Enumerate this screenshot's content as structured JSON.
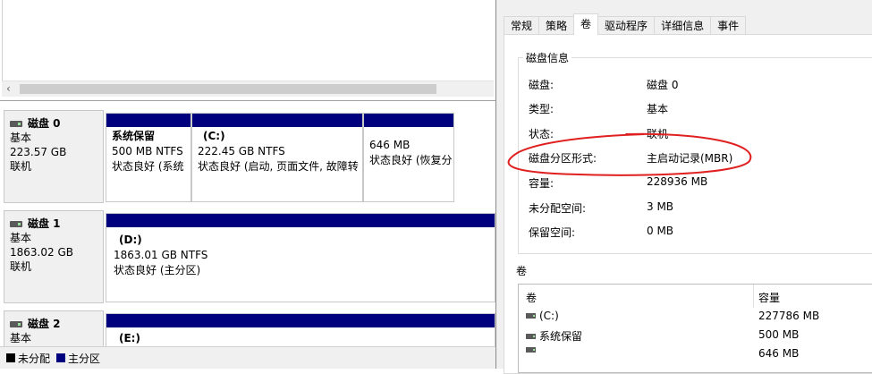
{
  "legend": {
    "unallocated": "未分配",
    "primary": "主分区"
  },
  "disks": [
    {
      "name": "磁盘 0",
      "type": "基本",
      "size": "223.57 GB",
      "status": "联机",
      "partitions": [
        {
          "name": "系统保留",
          "size": "500 MB NTFS",
          "status": "状态良好 (系统"
        },
        {
          "name": "(C:)",
          "size": "222.45 GB NTFS",
          "status": "状态良好 (启动, 页面文件, 故障转"
        },
        {
          "name": "",
          "size": "646 MB",
          "status": "状态良好 (恢复分"
        }
      ]
    },
    {
      "name": "磁盘 1",
      "type": "基本",
      "size": "1863.02 GB",
      "status": "联机",
      "partitions": [
        {
          "name": "(D:)",
          "size": "1863.01 GB NTFS",
          "status": "状态良好 (主分区)"
        }
      ]
    },
    {
      "name": "磁盘 2",
      "type": "基本",
      "partitions": [
        {
          "name": "(E:)"
        }
      ]
    }
  ],
  "dialog": {
    "tabs": [
      "常规",
      "策略",
      "卷",
      "驱动程序",
      "详细信息",
      "事件"
    ],
    "active_tab": "卷",
    "disk_info_title": "磁盘信息",
    "info": [
      {
        "label": "磁盘:",
        "value": "磁盘 0"
      },
      {
        "label": "类型:",
        "value": "基本"
      },
      {
        "label": "状态:",
        "value": "联机"
      },
      {
        "label": "磁盘分区形式:",
        "value": "主启动记录(MBR)"
      },
      {
        "label": "容量:",
        "value": "228936 MB"
      },
      {
        "label": "未分配空间:",
        "value": "3 MB"
      },
      {
        "label": "保留空间:",
        "value": "0 MB"
      }
    ],
    "volumes_title": "卷",
    "volumes_header": {
      "volume": "卷",
      "capacity": "容量"
    },
    "volumes": [
      {
        "volume": "(C:)",
        "capacity": "227786 MB"
      },
      {
        "volume": "系统保留",
        "capacity": "500 MB"
      },
      {
        "volume": "",
        "capacity": "646 MB"
      }
    ]
  },
  "colors": {
    "primary_partition": "#00007f",
    "annotation": "#e02020",
    "dialog_bg": "#f0f0f0"
  }
}
